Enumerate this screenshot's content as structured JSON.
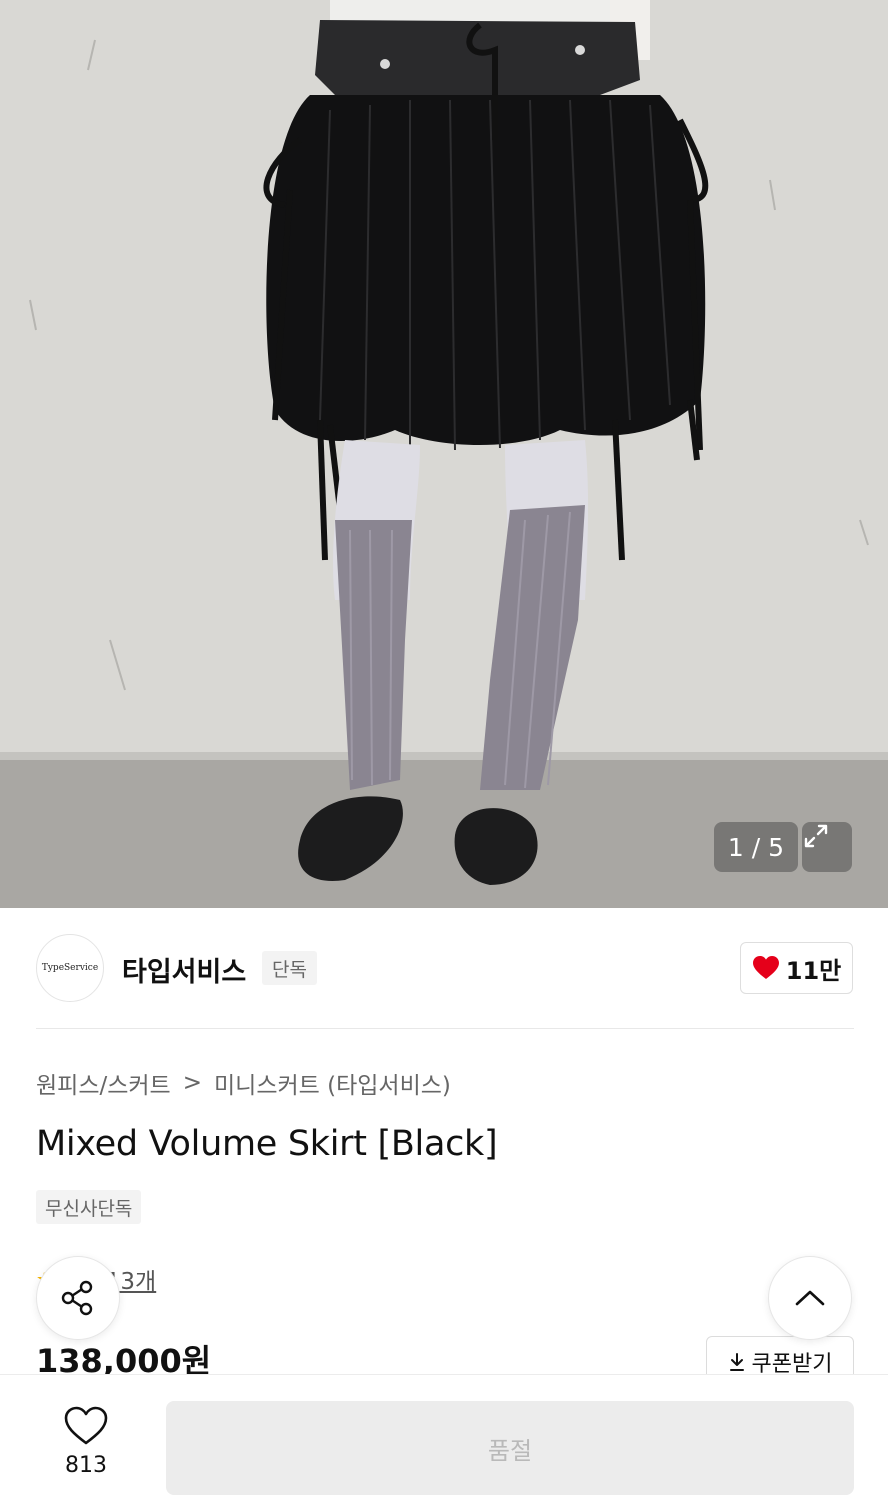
{
  "photo": {
    "counter": "1 / 5",
    "icons": {
      "expand": "expand-icon"
    }
  },
  "brand": {
    "logo_text": "TypeService",
    "name": "타입서비스",
    "exclusive_badge": "단독",
    "likes": "11만",
    "like_color": "#e5001a"
  },
  "product": {
    "breadcrumb": [
      "원피스/스커트",
      ">",
      "미니스커트 (타입서비스)"
    ],
    "title": "Mixed Volume Skirt [Black]",
    "badge": "무신사단독",
    "review_link": "후기 13개",
    "price": "138,000원",
    "coupon_label": "쿠폰받기"
  },
  "bottom_bar": {
    "wish_count": "813",
    "soldout_label": "품절"
  }
}
